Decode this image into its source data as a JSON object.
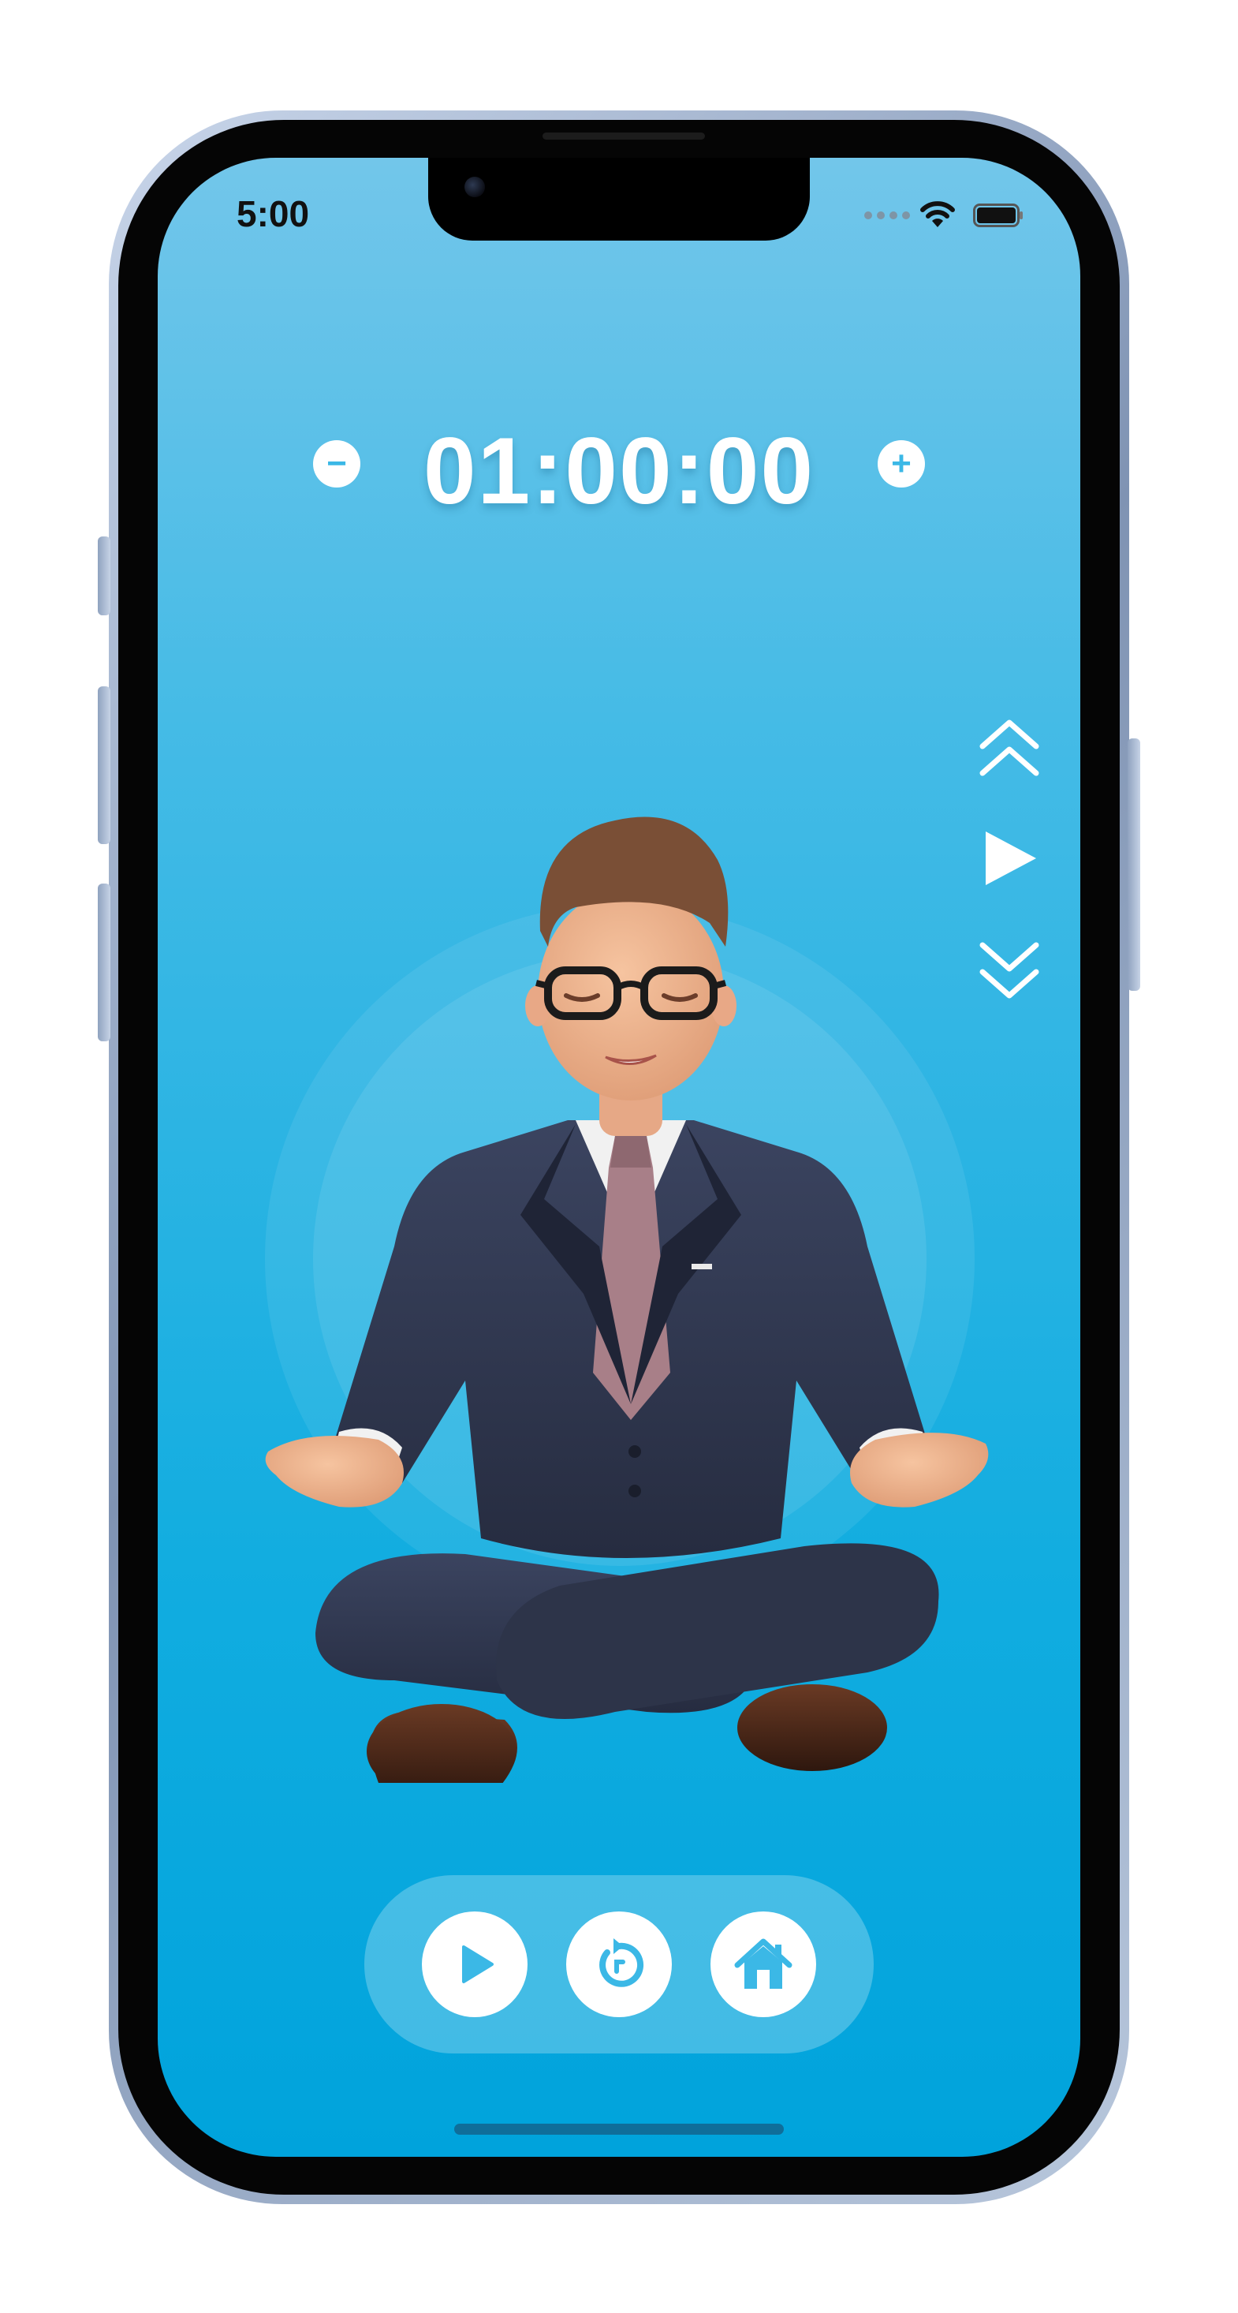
{
  "status_bar": {
    "time": "5:00"
  },
  "timer": {
    "display": "01:00:00",
    "decrease_symbol": "−",
    "increase_symbol": "+"
  },
  "side_controls": {
    "icons": [
      "double-chevron-up-icon",
      "play-icon",
      "double-chevron-down-icon"
    ]
  },
  "bottom_controls": {
    "icons": [
      "play-icon",
      "restart-icon",
      "home-icon"
    ]
  },
  "colors": {
    "accent": "#3bb8e6",
    "background_top": "#72c6ea",
    "background_bottom": "#00a3dc",
    "text": "#ffffff"
  }
}
